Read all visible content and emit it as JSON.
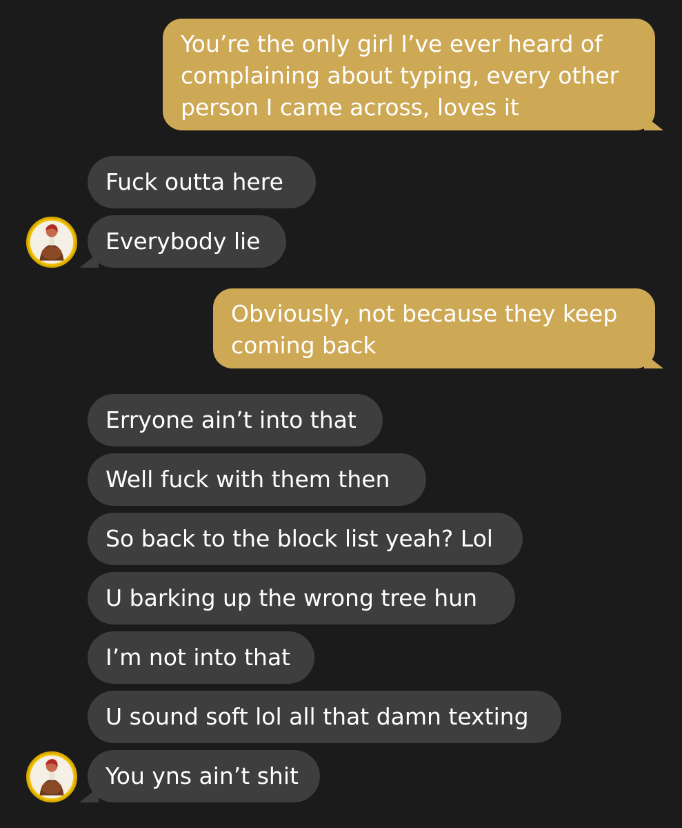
{
  "conversation": {
    "messages": [
      {
        "direction": "sent",
        "text": "You’re the only girl I’ve ever heard of complaining about typing, every other person I came across, loves it"
      },
      {
        "direction": "received",
        "text": "Fuck outta here"
      },
      {
        "direction": "received",
        "text": "Everybody lie"
      },
      {
        "direction": "sent",
        "text": "Obviously, not because they keep coming back"
      },
      {
        "direction": "received",
        "text": "Erryone ain’t into that"
      },
      {
        "direction": "received",
        "text": "Well fuck with them then"
      },
      {
        "direction": "received",
        "text": "So back to the block list yeah? Lol"
      },
      {
        "direction": "received",
        "text": "U barking up the wrong tree hun"
      },
      {
        "direction": "received",
        "text": "I’m not into that"
      },
      {
        "direction": "received",
        "text": "U sound soft lol all that damn texting"
      },
      {
        "direction": "received",
        "text": "You yns ain’t shit"
      }
    ]
  },
  "colors": {
    "background": "#1b1b1b",
    "sent_bubble": "#cda855",
    "received_bubble": "#3e3e3e",
    "avatar_ring": "#f2c200"
  },
  "icons": {
    "contact_avatar": "contact-avatar-icon"
  }
}
